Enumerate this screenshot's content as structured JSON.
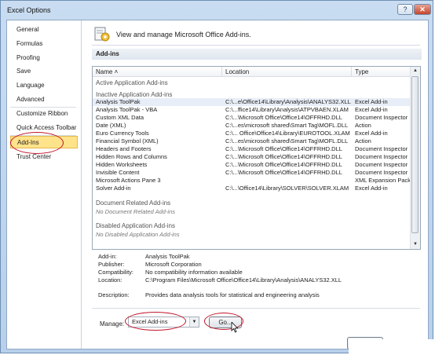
{
  "window": {
    "title": "Excel Options",
    "help": "?",
    "close": "✕"
  },
  "sidebar": {
    "items": [
      {
        "label": "General"
      },
      {
        "label": "Formulas"
      },
      {
        "label": "Proofing"
      },
      {
        "label": "Save"
      },
      {
        "label": "Language"
      },
      {
        "label": "Advanced"
      },
      {
        "label": "Customize Ribbon"
      },
      {
        "label": "Quick Access Toolbar"
      },
      {
        "label": "Add-Ins"
      },
      {
        "label": "Trust Center"
      }
    ],
    "selected": "Add-Ins"
  },
  "main": {
    "header": "View and manage Microsoft Office Add-ins.",
    "section": "Add-ins",
    "columns": {
      "name": "Name",
      "location": "Location",
      "type": "Type"
    },
    "groups": {
      "active": "Active Application Add-ins",
      "inactive": "Inactive Application Add-ins",
      "document": "Document Related Add-ins",
      "document_none": "No Document Related Add-ins",
      "disabled": "Disabled Application Add-ins",
      "disabled_none": "No Disabled Application Add-ins"
    },
    "rows": [
      {
        "name": "Analysis ToolPak",
        "location": "C:\\...e\\Office14\\Library\\Analysis\\ANALYS32.XLL",
        "type": "Excel Add-in"
      },
      {
        "name": "Analysis ToolPak - VBA",
        "location": "C:\\...ffice14\\Library\\Analysis\\ATPVBAEN.XLAM",
        "type": "Excel Add-in"
      },
      {
        "name": "Custom XML Data",
        "location": "C:\\...\\Microsoft Office\\Office14\\OFFRHD.DLL",
        "type": "Document Inspector"
      },
      {
        "name": "Date (XML)",
        "location": "C:\\...es\\microsoft shared\\Smart Tag\\MOFL.DLL",
        "type": "Action"
      },
      {
        "name": "Euro Currency Tools",
        "location": "C:\\... Office\\Office14\\Library\\EUROTOOL.XLAM",
        "type": "Excel Add-in"
      },
      {
        "name": "Financial Symbol (XML)",
        "location": "C:\\...es\\microsoft shared\\Smart Tag\\MOFL.DLL",
        "type": "Action"
      },
      {
        "name": "Headers and Footers",
        "location": "C:\\...\\Microsoft Office\\Office14\\OFFRHD.DLL",
        "type": "Document Inspector"
      },
      {
        "name": "Hidden Rows and Columns",
        "location": "C:\\...\\Microsoft Office\\Office14\\OFFRHD.DLL",
        "type": "Document Inspector"
      },
      {
        "name": "Hidden Worksheets",
        "location": "C:\\...\\Microsoft Office\\Office14\\OFFRHD.DLL",
        "type": "Document Inspector"
      },
      {
        "name": "Invisible Content",
        "location": "C:\\...\\Microsoft Office\\Office14\\OFFRHD.DLL",
        "type": "Document Inspector"
      },
      {
        "name": "Microsoft Actions Pane 3",
        "location": "",
        "type": "XML Expansion Pack"
      },
      {
        "name": "Solver Add-in",
        "location": "C:\\...\\Office14\\Library\\SOLVER\\SOLVER.XLAM",
        "type": "Excel Add-in"
      }
    ],
    "details": {
      "addin_label": "Add-in:",
      "addin": "Analysis ToolPak",
      "publisher_label": "Publisher:",
      "publisher": "Microsoft Corporation",
      "compat_label": "Compatibility:",
      "compat": "No compatibility information available",
      "location_label": "Location:",
      "location": "C:\\Program Files\\Microsoft Office\\Office14\\Library\\Analysis\\ANALYS32.XLL",
      "desc_label": "Description:",
      "desc": "Provides data analysis tools for statistical and engineering analysis"
    },
    "manage": {
      "label": "Manage:",
      "value": "Excel Add-ins",
      "go": "Go..."
    }
  },
  "colors": {
    "selected_nav": "#ffe38a",
    "annotation": "#c0142a"
  }
}
